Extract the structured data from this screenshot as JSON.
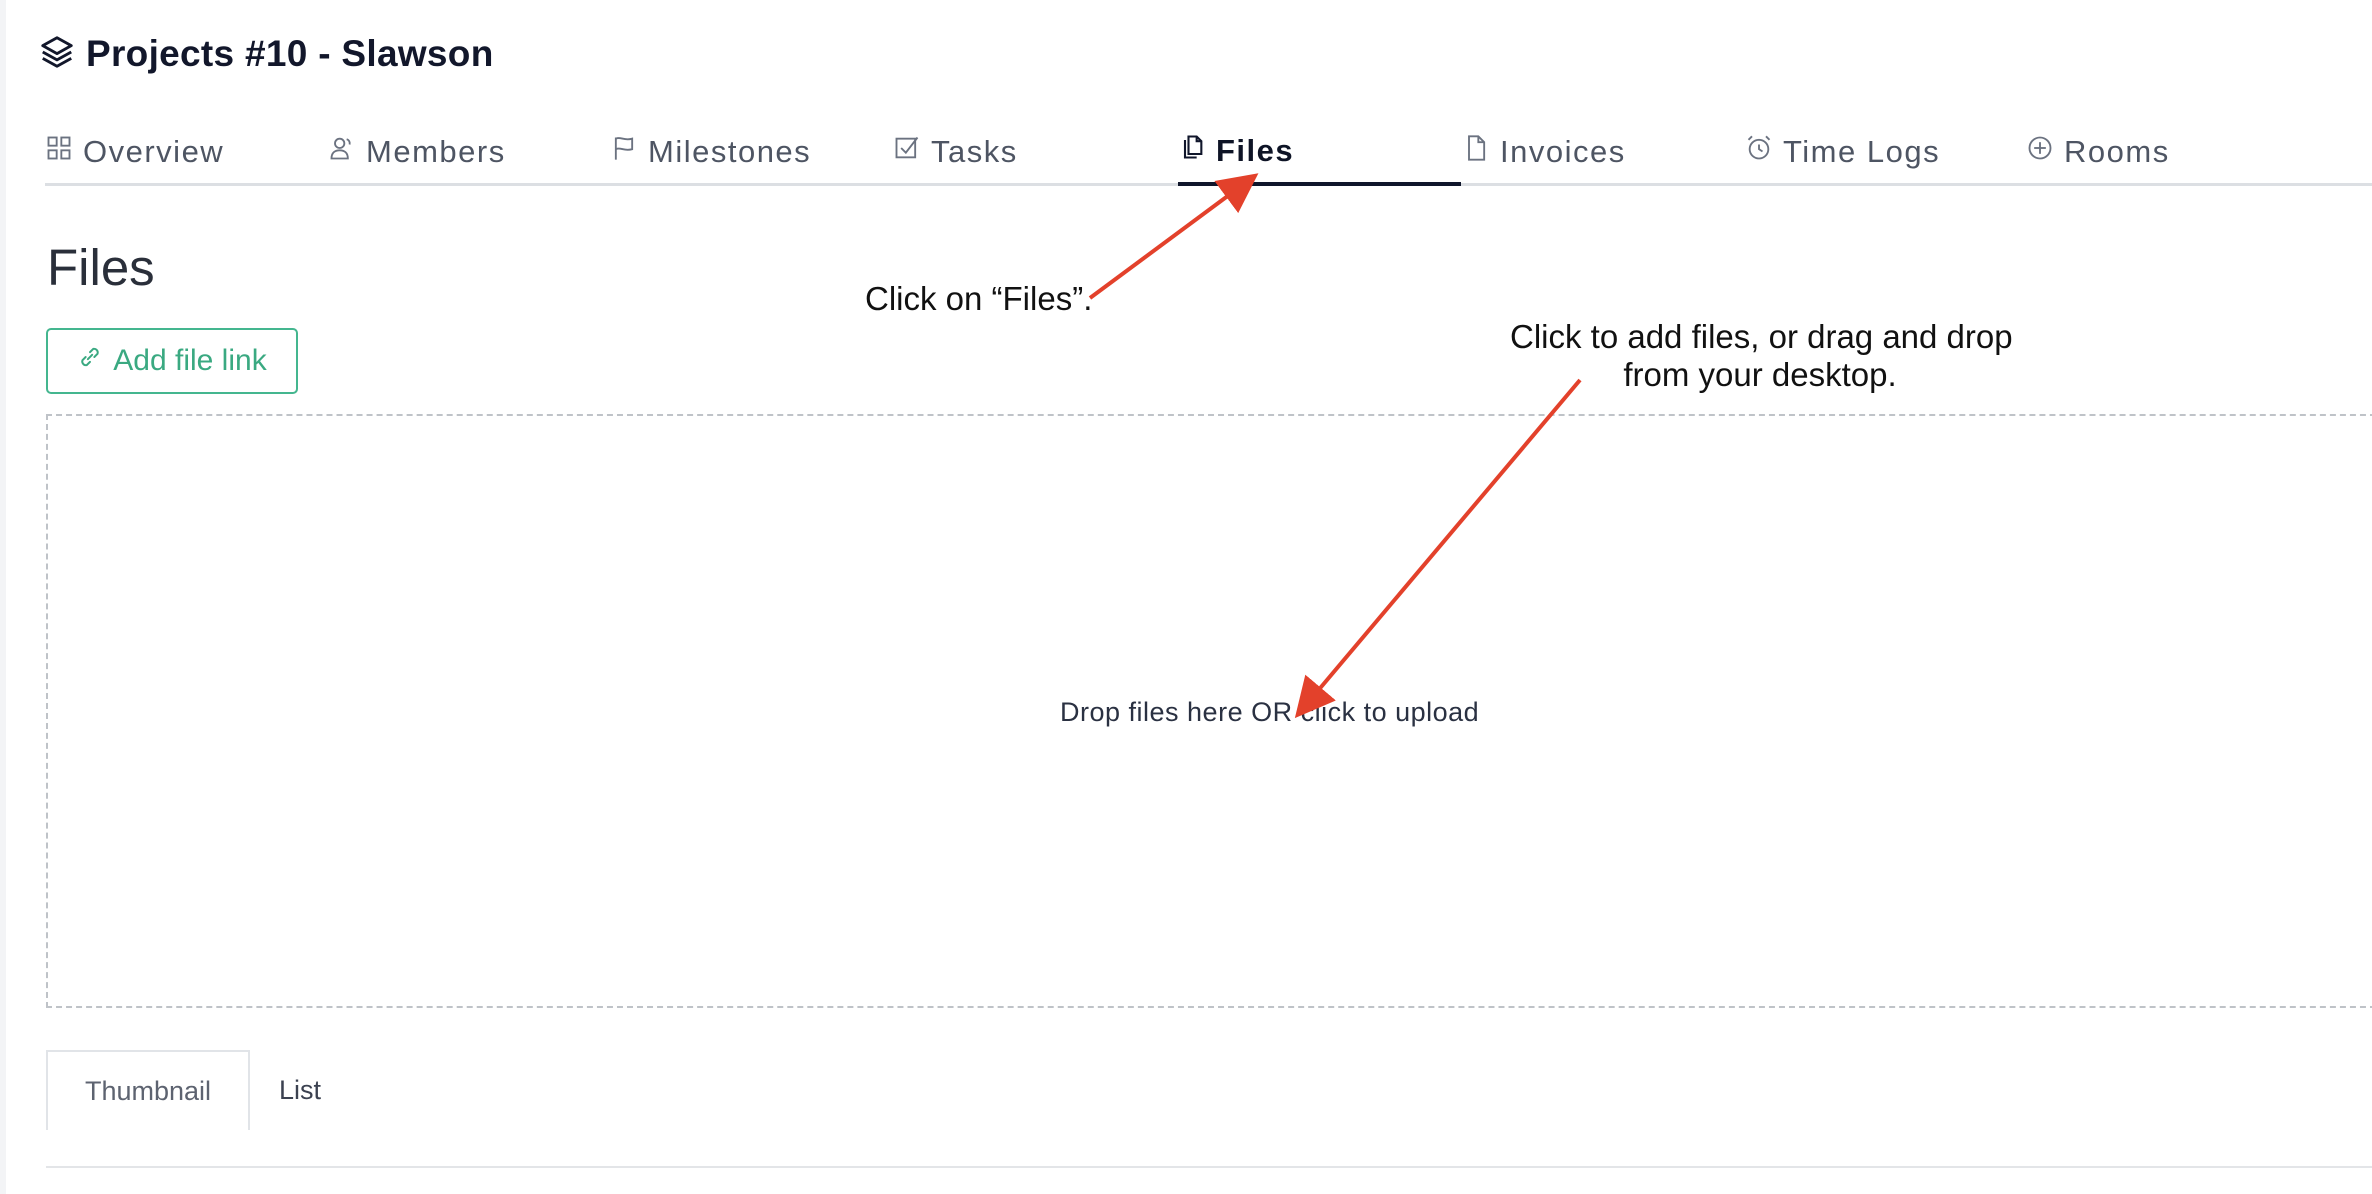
{
  "page": {
    "title": "Projects #10 - Slawson",
    "title_icon": "layers-icon"
  },
  "tabs": [
    {
      "label": "Overview",
      "icon": "grid-icon",
      "active": false
    },
    {
      "label": "Members",
      "icon": "users-icon",
      "active": false
    },
    {
      "label": "Milestones",
      "icon": "flag-icon",
      "active": false
    },
    {
      "label": "Tasks",
      "icon": "checkbox-icon",
      "active": false
    },
    {
      "label": "Files",
      "icon": "files-icon",
      "active": true
    },
    {
      "label": "Invoices",
      "icon": "document-icon",
      "active": false
    },
    {
      "label": "Time Logs",
      "icon": "alarm-clock-icon",
      "active": false
    },
    {
      "label": "Rooms",
      "icon": "plus-circle-icon",
      "active": false
    }
  ],
  "files_section": {
    "title": "Files",
    "add_link_label": "Add file link",
    "add_link_icon": "link-icon",
    "dropzone_text": "Drop files here OR click to upload"
  },
  "view_tabs": [
    {
      "label": "Thumbnail",
      "active": true
    },
    {
      "label": "List",
      "active": false
    }
  ],
  "annotations": {
    "files_tab_hint": "Click on “Files”.",
    "upload_hint_line1": "Click to add files, or drag and drop",
    "upload_hint_line2": "from your desktop.",
    "arrow_color": "#e3412b"
  },
  "colors": {
    "accent_green": "#3aa981",
    "active_tab_underline": "#10162b",
    "title_color": "#12172b"
  }
}
